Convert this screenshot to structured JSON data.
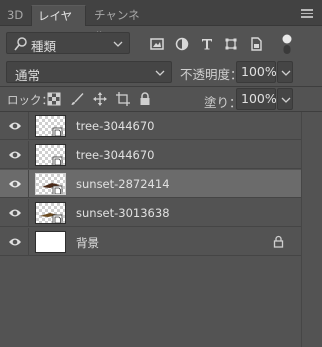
{
  "tabs": [
    {
      "label": "3D"
    },
    {
      "label": "レイヤー"
    },
    {
      "label": "チャンネル"
    }
  ],
  "filter": {
    "kind_label": "種類",
    "filter_icons": [
      "image-filter-icon",
      "adjustment-filter-icon",
      "type-filter-icon",
      "shape-filter-icon",
      "smart-object-filter-icon"
    ]
  },
  "blend": {
    "mode": "通常",
    "opacity_label": "不透明度：",
    "opacity_value": "100%"
  },
  "lock": {
    "label": "ロック：",
    "lock_icons": [
      "lock-transparent-pixels-icon",
      "lock-image-pixels-icon",
      "lock-position-icon",
      "lock-artboard-icon",
      "lock-all-icon"
    ],
    "fill_label": "塗り：",
    "fill_value": "100%"
  },
  "layers": [
    {
      "name": "tree-3044670",
      "visible": true,
      "selected": false,
      "thumb": "transparent"
    },
    {
      "name": "tree-3044670",
      "visible": true,
      "selected": false,
      "thumb": "transparent"
    },
    {
      "name": "sunset-2872414",
      "visible": true,
      "selected": true,
      "thumb": "transparent"
    },
    {
      "name": "sunset-3013638",
      "visible": true,
      "selected": false,
      "thumb": "transparent"
    },
    {
      "name": "背景",
      "visible": true,
      "selected": false,
      "thumb": "white",
      "locked": true
    }
  ],
  "colors": {
    "panel_bg": "#535353",
    "selected_row": "#6b6b6b",
    "tabbar_bg": "#424242"
  }
}
